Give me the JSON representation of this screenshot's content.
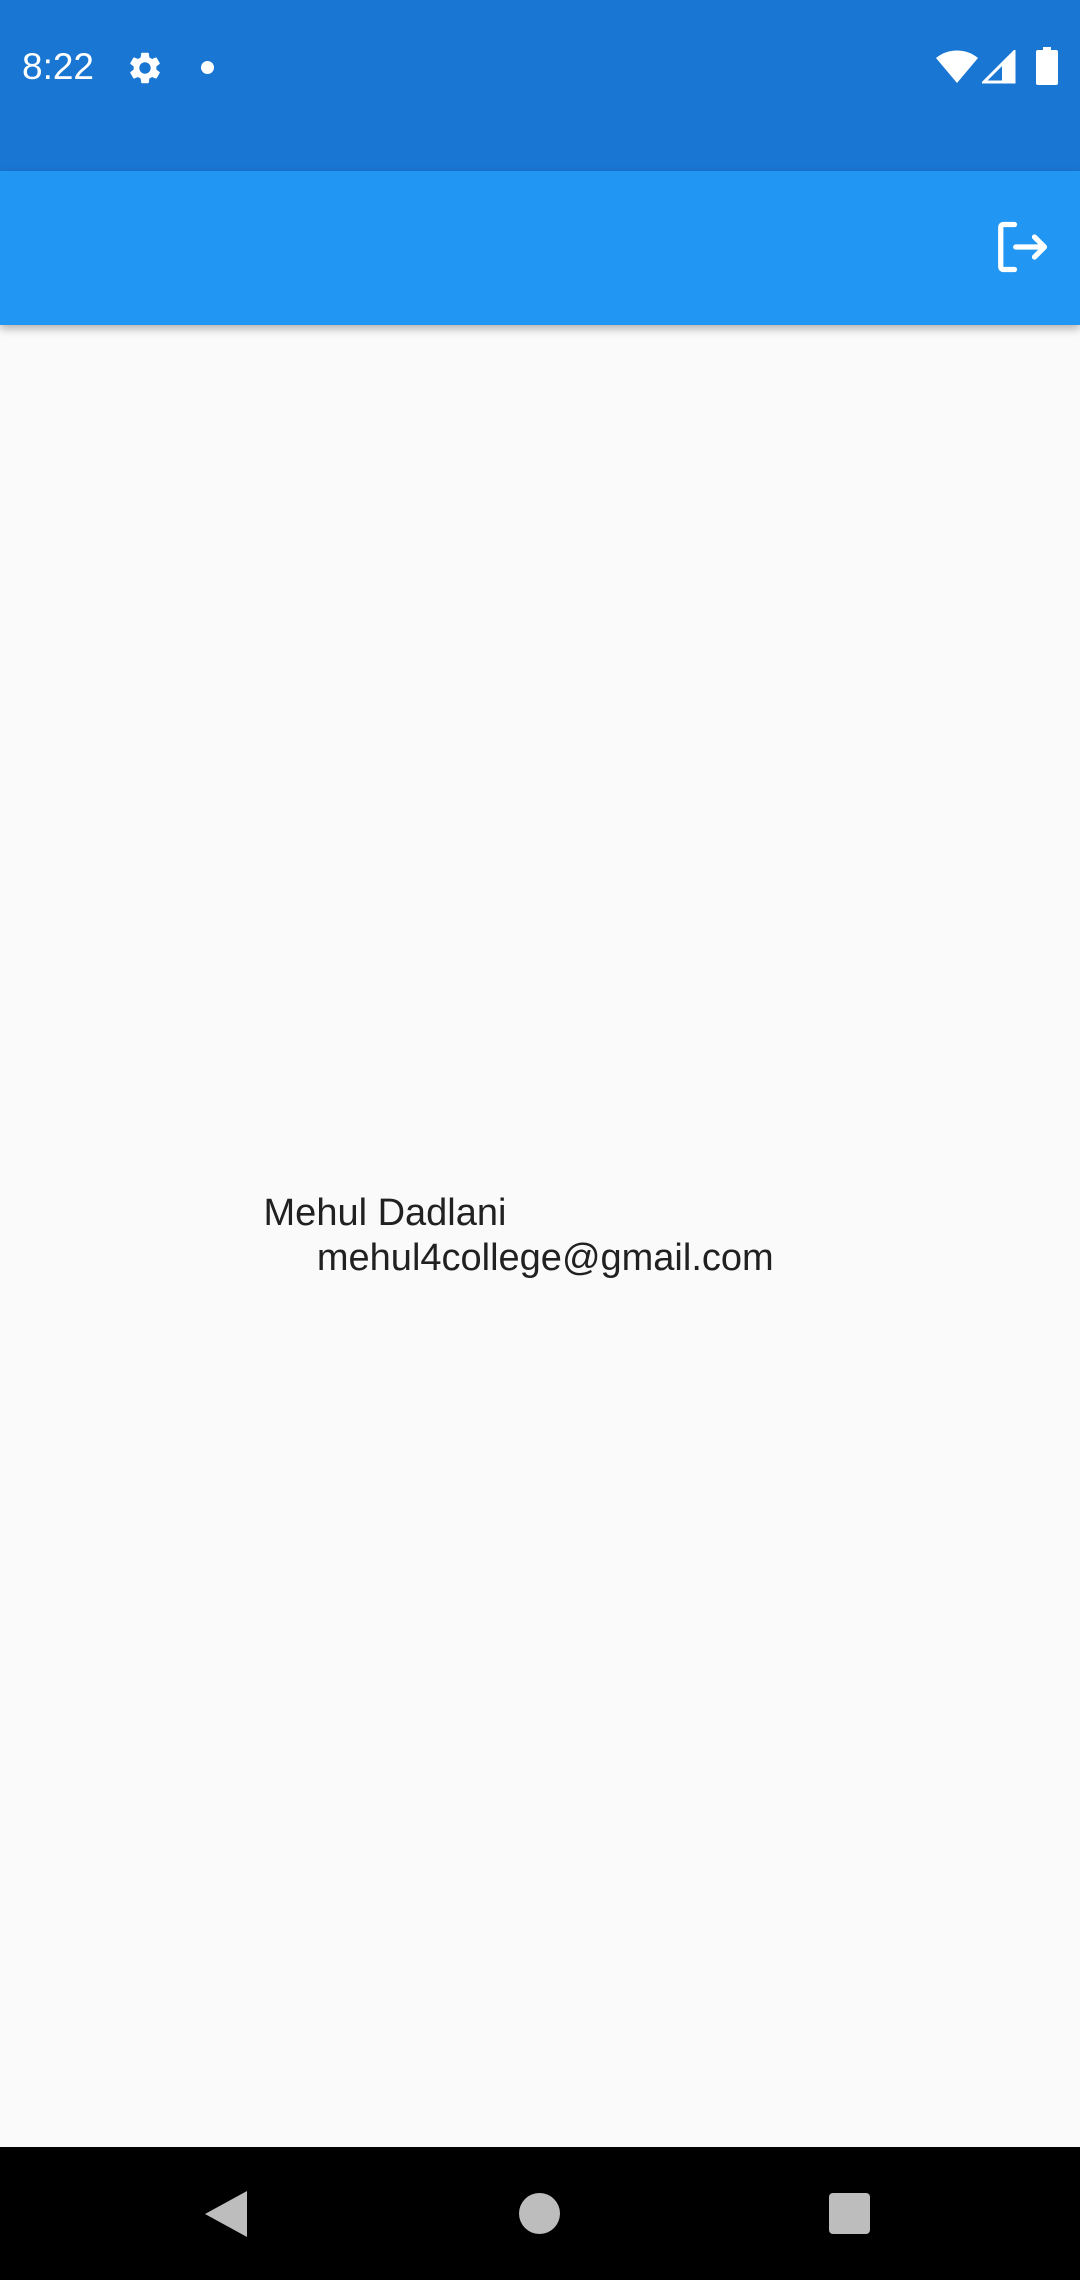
{
  "status_bar": {
    "time": "8:22",
    "icons": [
      "gear-icon",
      "notification-dot-icon",
      "wifi-icon",
      "cell-signal-icon",
      "battery-icon"
    ]
  },
  "app_bar": {
    "logout_icon": "logout-icon",
    "background_color": "#2196f3"
  },
  "user": {
    "name": "Mehul Dadlani",
    "email": " mehul4college@gmail.com"
  },
  "nav_bar": {
    "icons": [
      "back-icon",
      "home-icon",
      "recents-icon"
    ]
  },
  "colors": {
    "status_bar": "#1976d2",
    "app_bar": "#2196f3",
    "background": "#fafafa",
    "text": "#212121",
    "nav_bar": "#000000"
  }
}
